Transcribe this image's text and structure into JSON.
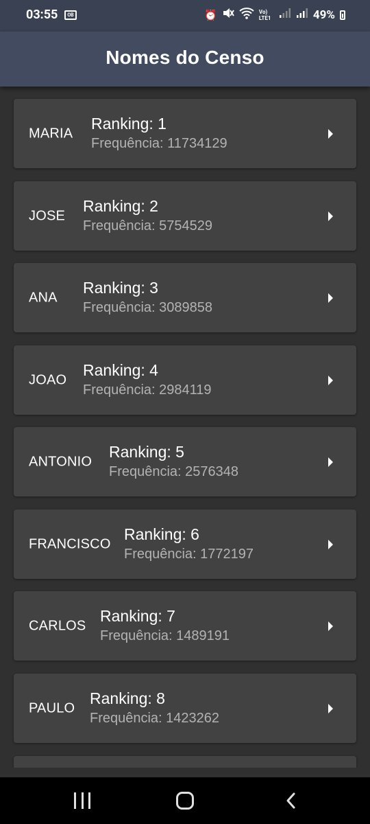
{
  "status_bar": {
    "time": "03:55",
    "left_badge": "OB",
    "icons": [
      "alarm-icon",
      "mute-icon",
      "wifi-icon",
      "volte-icon",
      "signal-icon",
      "signal-icon"
    ],
    "volte_text": "Vo) LTE1",
    "battery_percent": "49%"
  },
  "app_bar": {
    "title": "Nomes do Censo"
  },
  "cards": [
    {
      "name": "MARIA",
      "ranking": "Ranking: 1",
      "frequency": "Frequência: 11734129"
    },
    {
      "name": "JOSE",
      "ranking": "Ranking: 2",
      "frequency": "Frequência: 5754529"
    },
    {
      "name": "ANA",
      "ranking": "Ranking: 3",
      "frequency": "Frequência: 3089858"
    },
    {
      "name": "JOAO",
      "ranking": "Ranking: 4",
      "frequency": "Frequência: 2984119"
    },
    {
      "name": "ANTONIO",
      "ranking": "Ranking: 5",
      "frequency": "Frequência: 2576348"
    },
    {
      "name": "FRANCISCO",
      "ranking": "Ranking: 6",
      "frequency": "Frequência: 1772197"
    },
    {
      "name": "CARLOS",
      "ranking": "Ranking: 7",
      "frequency": "Frequência: 1489191"
    },
    {
      "name": "PAULO",
      "ranking": "Ranking: 8",
      "frequency": "Frequência: 1423262"
    },
    {
      "name": "",
      "ranking": "",
      "frequency": ""
    }
  ],
  "nav_bar": {
    "icons": [
      "recent-apps-icon",
      "home-icon",
      "back-icon"
    ]
  },
  "colors": {
    "background": "#303030",
    "app_bar": "#424b5f",
    "status_bar": "#3a4152",
    "card": "#424242",
    "secondary_text": "#b3b3b3"
  }
}
